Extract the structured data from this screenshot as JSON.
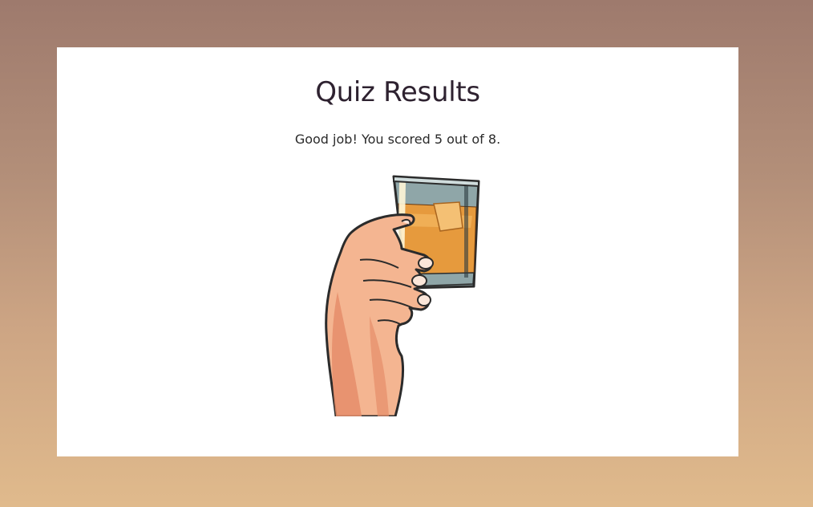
{
  "results": {
    "title": "Quiz Results",
    "message": "Good job! You scored 5 out of 8.",
    "score": 5,
    "total": 8
  },
  "illustration": {
    "icon": "hand-holding-glass-icon"
  },
  "colors": {
    "background_top": "#9e7a6d",
    "background_bottom": "#e0ba8c",
    "card": "#ffffff",
    "title_text": "#2e2230"
  }
}
